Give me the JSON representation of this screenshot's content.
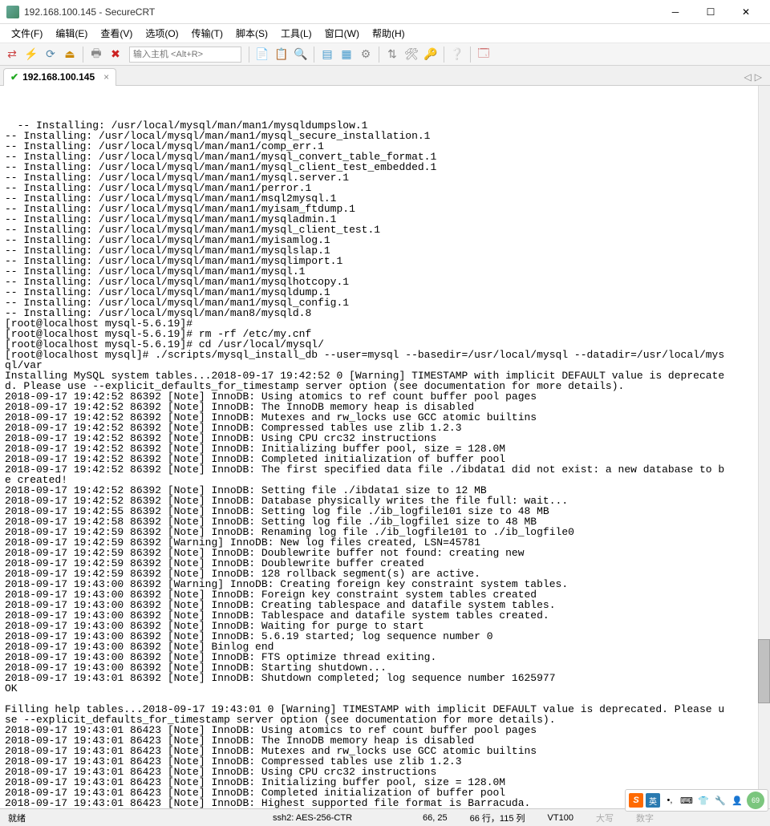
{
  "window": {
    "title": "192.168.100.145 - SecureCRT"
  },
  "menu": {
    "file": "文件(F)",
    "edit": "编辑(E)",
    "view": "查看(V)",
    "options": "选项(O)",
    "transfer": "传输(T)",
    "script": "脚本(S)",
    "tools": "工具(L)",
    "window": "窗口(W)",
    "help": "帮助(H)"
  },
  "toolbar": {
    "host_placeholder": "输入主机 <Alt+R>"
  },
  "tab": {
    "label": "192.168.100.145",
    "close": "×"
  },
  "status": {
    "ready": "就绪",
    "conn": "ssh2: AES-256-CTR",
    "pos": "66, 25",
    "size": "66 行，115 列",
    "vt": "VT100",
    "caps": "大写",
    "num": "数字"
  },
  "ime": {
    "lang": "英",
    "badge": "69"
  },
  "terminal": "-- Installing: /usr/local/mysql/man/man1/mysqldumpslow.1\n-- Installing: /usr/local/mysql/man/man1/mysql_secure_installation.1\n-- Installing: /usr/local/mysql/man/man1/comp_err.1\n-- Installing: /usr/local/mysql/man/man1/mysql_convert_table_format.1\n-- Installing: /usr/local/mysql/man/man1/mysql_client_test_embedded.1\n-- Installing: /usr/local/mysql/man/man1/mysql.server.1\n-- Installing: /usr/local/mysql/man/man1/perror.1\n-- Installing: /usr/local/mysql/man/man1/msql2mysql.1\n-- Installing: /usr/local/mysql/man/man1/myisam_ftdump.1\n-- Installing: /usr/local/mysql/man/man1/mysqladmin.1\n-- Installing: /usr/local/mysql/man/man1/mysql_client_test.1\n-- Installing: /usr/local/mysql/man/man1/myisamlog.1\n-- Installing: /usr/local/mysql/man/man1/mysqlslap.1\n-- Installing: /usr/local/mysql/man/man1/mysqlimport.1\n-- Installing: /usr/local/mysql/man/man1/mysql.1\n-- Installing: /usr/local/mysql/man/man1/mysqlhotcopy.1\n-- Installing: /usr/local/mysql/man/man1/mysqldump.1\n-- Installing: /usr/local/mysql/man/man1/mysql_config.1\n-- Installing: /usr/local/mysql/man/man8/mysqld.8\n[root@localhost mysql-5.6.19]#\n[root@localhost mysql-5.6.19]# rm -rf /etc/my.cnf\n[root@localhost mysql-5.6.19]# cd /usr/local/mysql/\n[root@localhost mysql]# ./scripts/mysql_install_db --user=mysql --basedir=/usr/local/mysql --datadir=/usr/local/mys\nql/var\nInstalling MySQL system tables...2018-09-17 19:42:52 0 [Warning] TIMESTAMP with implicit DEFAULT value is deprecate\nd. Please use --explicit_defaults_for_timestamp server option (see documentation for more details).\n2018-09-17 19:42:52 86392 [Note] InnoDB: Using atomics to ref count buffer pool pages\n2018-09-17 19:42:52 86392 [Note] InnoDB: The InnoDB memory heap is disabled\n2018-09-17 19:42:52 86392 [Note] InnoDB: Mutexes and rw_locks use GCC atomic builtins\n2018-09-17 19:42:52 86392 [Note] InnoDB: Compressed tables use zlib 1.2.3\n2018-09-17 19:42:52 86392 [Note] InnoDB: Using CPU crc32 instructions\n2018-09-17 19:42:52 86392 [Note] InnoDB: Initializing buffer pool, size = 128.0M\n2018-09-17 19:42:52 86392 [Note] InnoDB: Completed initialization of buffer pool\n2018-09-17 19:42:52 86392 [Note] InnoDB: The first specified data file ./ibdata1 did not exist: a new database to b\ne created!\n2018-09-17 19:42:52 86392 [Note] InnoDB: Setting file ./ibdata1 size to 12 MB\n2018-09-17 19:42:52 86392 [Note] InnoDB: Database physically writes the file full: wait...\n2018-09-17 19:42:55 86392 [Note] InnoDB: Setting log file ./ib_logfile101 size to 48 MB\n2018-09-17 19:42:58 86392 [Note] InnoDB: Setting log file ./ib_logfile1 size to 48 MB\n2018-09-17 19:42:59 86392 [Note] InnoDB: Renaming log file ./ib_logfile101 to ./ib_logfile0\n2018-09-17 19:42:59 86392 [Warning] InnoDB: New log files created, LSN=45781\n2018-09-17 19:42:59 86392 [Note] InnoDB: Doublewrite buffer not found: creating new\n2018-09-17 19:42:59 86392 [Note] InnoDB: Doublewrite buffer created\n2018-09-17 19:42:59 86392 [Note] InnoDB: 128 rollback segment(s) are active.\n2018-09-17 19:43:00 86392 [Warning] InnoDB: Creating foreign key constraint system tables.\n2018-09-17 19:43:00 86392 [Note] InnoDB: Foreign key constraint system tables created\n2018-09-17 19:43:00 86392 [Note] InnoDB: Creating tablespace and datafile system tables.\n2018-09-17 19:43:00 86392 [Note] InnoDB: Tablespace and datafile system tables created.\n2018-09-17 19:43:00 86392 [Note] InnoDB: Waiting for purge to start\n2018-09-17 19:43:00 86392 [Note] InnoDB: 5.6.19 started; log sequence number 0\n2018-09-17 19:43:00 86392 [Note] Binlog end\n2018-09-17 19:43:00 86392 [Note] InnoDB: FTS optimize thread exiting.\n2018-09-17 19:43:00 86392 [Note] InnoDB: Starting shutdown...\n2018-09-17 19:43:01 86392 [Note] InnoDB: Shutdown completed; log sequence number 1625977\nOK\n\nFilling help tables...2018-09-17 19:43:01 0 [Warning] TIMESTAMP with implicit DEFAULT value is deprecated. Please u\nse --explicit_defaults_for_timestamp server option (see documentation for more details).\n2018-09-17 19:43:01 86423 [Note] InnoDB: Using atomics to ref count buffer pool pages\n2018-09-17 19:43:01 86423 [Note] InnoDB: The InnoDB memory heap is disabled\n2018-09-17 19:43:01 86423 [Note] InnoDB: Mutexes and rw_locks use GCC atomic builtins\n2018-09-17 19:43:01 86423 [Note] InnoDB: Compressed tables use zlib 1.2.3\n2018-09-17 19:43:01 86423 [Note] InnoDB: Using CPU crc32 instructions\n2018-09-17 19:43:01 86423 [Note] InnoDB: Initializing buffer pool, size = 128.0M\n2018-09-17 19:43:01 86423 [Note] InnoDB: Completed initialization of buffer pool\n2018-09-17 19:43:01 86423 [Note] InnoDB: Highest supported file format is Barracuda."
}
